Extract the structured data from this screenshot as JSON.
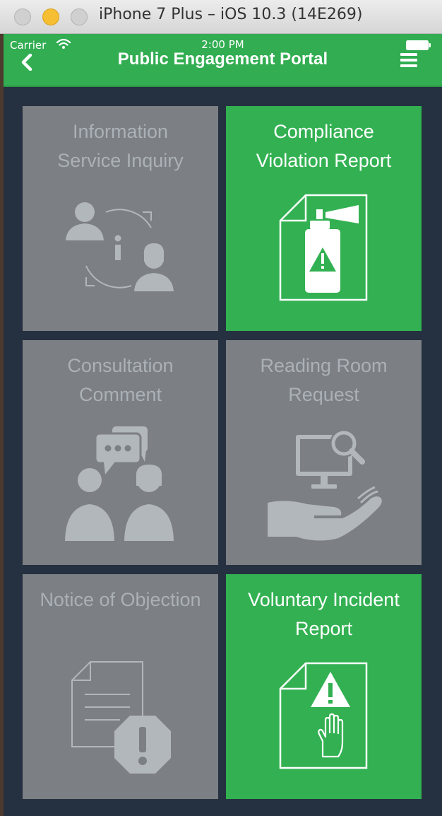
{
  "window": {
    "title": "iPhone 7 Plus – iOS 10.3 (14E269)"
  },
  "status_bar": {
    "carrier": "Carrier",
    "time": "2:00 PM"
  },
  "navbar": {
    "title": "Public Engagement Portal"
  },
  "tiles": [
    {
      "line1": "Information",
      "line2": "Service Inquiry",
      "icon": "information-exchange-icon",
      "state": "disabled"
    },
    {
      "line1": "Compliance",
      "line2": "Violation Report",
      "icon": "spray-can-warning-icon",
      "state": "active"
    },
    {
      "line1": "Consultation",
      "line2": "Comment",
      "icon": "people-discussion-icon",
      "state": "disabled"
    },
    {
      "line1": "Reading Room",
      "line2": "Request",
      "icon": "monitor-search-hand-icon",
      "state": "disabled"
    },
    {
      "line1": "Notice of Objection",
      "line2": "",
      "icon": "document-exclamation-icon",
      "state": "disabled"
    },
    {
      "line1": "Voluntary Incident",
      "line2": "Report",
      "icon": "document-warning-hand-icon",
      "state": "active"
    }
  ],
  "colors": {
    "accent_green": "#33b152",
    "tile_gray": "#7c7f83",
    "background": "#253140",
    "gray_icon": "#b2b7bb"
  }
}
